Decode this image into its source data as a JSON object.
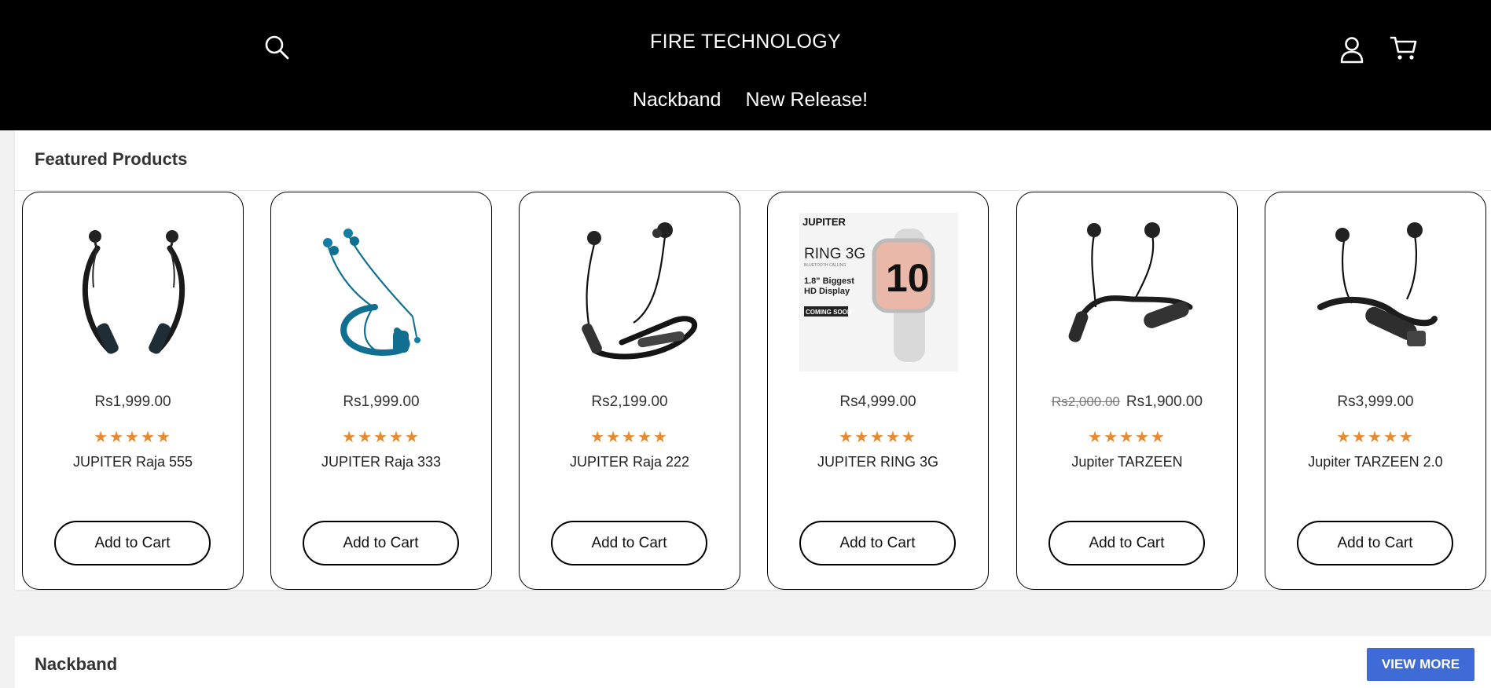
{
  "header": {
    "brand": "FIRE TECHNOLOGY",
    "nav": [
      {
        "label": "Nackband"
      },
      {
        "label": "New Release!"
      }
    ],
    "icons": {
      "search": "search-icon",
      "account": "user-icon",
      "cart": "cart-icon"
    }
  },
  "featured": {
    "title": "Featured Products",
    "products": [
      {
        "name": "JUPITER Raja 555",
        "price": "Rs1,999.00",
        "old_price": "",
        "rating": "★★★★★",
        "button": "Add to Cart",
        "image": "neckband-earphones-black"
      },
      {
        "name": "JUPITER Raja 333",
        "price": "Rs1,999.00",
        "old_price": "",
        "rating": "★★★★★",
        "button": "Add to Cart",
        "image": "neckband-earphones-blue"
      },
      {
        "name": "JUPITER Raja 222",
        "price": "Rs2,199.00",
        "old_price": "",
        "rating": "★★★★★",
        "button": "Add to Cart",
        "image": "neckband-earphones-black"
      },
      {
        "name": "JUPITER RING 3G",
        "price": "Rs4,999.00",
        "old_price": "",
        "rating": "★★★★★",
        "button": "Add to Cart",
        "image": "smartwatch-promo",
        "promo": {
          "logo": "JUPITER",
          "model": "RING 3G",
          "sub": "BLUETOOTH CALLING",
          "line1": "1.8\" Biggest",
          "line2": "HD Display",
          "badge": "COMING SOON",
          "watch_face": "10"
        }
      },
      {
        "name": "Jupiter TARZEEN",
        "price": "Rs1,900.00",
        "old_price": "Rs2,000.00",
        "rating": "★★★★★",
        "button": "Add to Cart",
        "image": "neckband-earphones-black"
      },
      {
        "name": "Jupiter TARZEEN 2.0",
        "price": "Rs3,999.00",
        "old_price": "",
        "rating": "★★★★★",
        "button": "Add to Cart",
        "image": "neckband-earphones-black"
      }
    ]
  },
  "nackband_section": {
    "title": "Nackband",
    "button": "VIEW MORE"
  },
  "colors": {
    "header_bg": "#000000",
    "star": "#e98a2f",
    "view_more": "#3e6bd6"
  }
}
